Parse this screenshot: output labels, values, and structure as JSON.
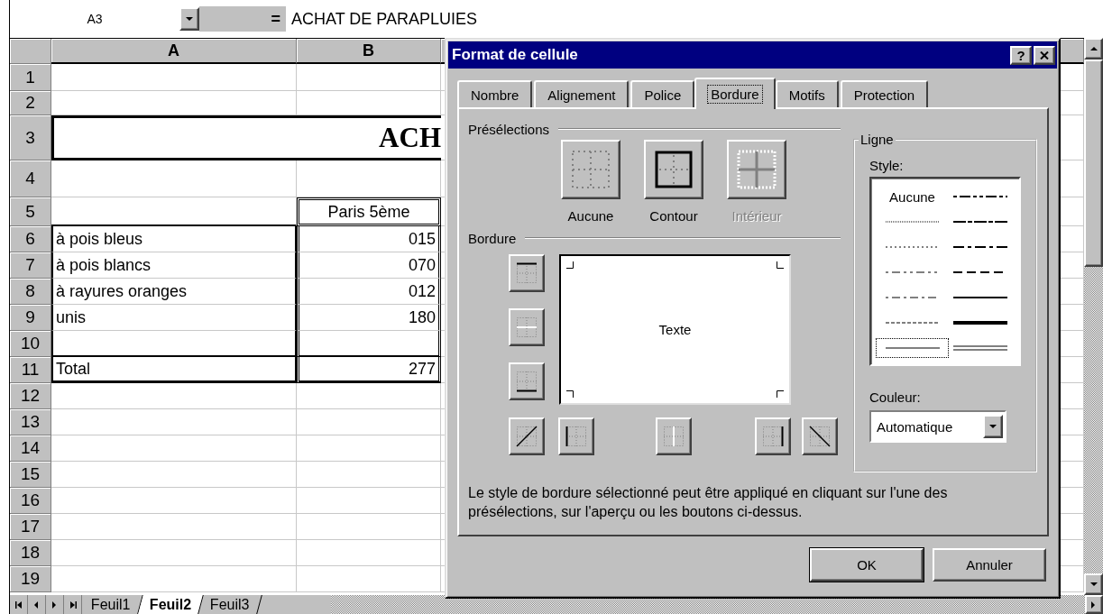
{
  "formula_bar": {
    "name_box": "A3",
    "equals_sign": "=",
    "formula": "ACHAT DE PARAPLUIES"
  },
  "sheet": {
    "columns": [
      "A",
      "B"
    ],
    "rows": [
      {
        "number": "1",
        "kind": "plain"
      },
      {
        "number": "2",
        "kind": "plain"
      },
      {
        "number": "3",
        "kind": "title",
        "text": "ACH"
      },
      {
        "number": "4",
        "kind": "plain"
      },
      {
        "number": "5",
        "kind": "header",
        "col_b": "Paris 5ème"
      },
      {
        "number": "6",
        "kind": "item",
        "col_a": "à pois bleus",
        "col_b": "015"
      },
      {
        "number": "7",
        "kind": "item",
        "col_a": "à pois blancs",
        "col_b": "070"
      },
      {
        "number": "8",
        "kind": "item",
        "col_a": "à rayures oranges",
        "col_b": "012"
      },
      {
        "number": "9",
        "kind": "item",
        "col_a": "unis",
        "col_b": "180"
      },
      {
        "number": "10",
        "kind": "spacer"
      },
      {
        "number": "11",
        "kind": "total",
        "col_a": "Total",
        "col_b": "277"
      },
      {
        "number": "12",
        "kind": "plain"
      },
      {
        "number": "13",
        "kind": "plain"
      },
      {
        "number": "14",
        "kind": "plain"
      },
      {
        "number": "15",
        "kind": "plain"
      },
      {
        "number": "16",
        "kind": "plain"
      },
      {
        "number": "17",
        "kind": "plain"
      },
      {
        "number": "18",
        "kind": "plain"
      },
      {
        "number": "19",
        "kind": "plain"
      }
    ],
    "tabs": [
      {
        "label": "Feuil1",
        "selected": false
      },
      {
        "label": "Feuil2",
        "selected": true
      },
      {
        "label": "Feuil3",
        "selected": false
      }
    ]
  },
  "dialog": {
    "title": "Format de cellule",
    "help": "?",
    "tabs": [
      {
        "label": "Nombre",
        "selected": false
      },
      {
        "label": "Alignement",
        "selected": false
      },
      {
        "label": "Police",
        "selected": false
      },
      {
        "label": "Bordure",
        "selected": true
      },
      {
        "label": "Motifs",
        "selected": false
      },
      {
        "label": "Protection",
        "selected": false
      }
    ],
    "presets": {
      "label": "Présélections",
      "items": [
        {
          "kind": "none",
          "label": "Aucune",
          "disabled": false
        },
        {
          "kind": "outline",
          "label": "Contour",
          "disabled": false
        },
        {
          "kind": "inside",
          "label": "Intérieur",
          "disabled": true
        }
      ]
    },
    "border": {
      "label": "Bordure",
      "preview_text": "Texte"
    },
    "line": {
      "label": "Ligne",
      "style_label": "Style:",
      "styles": [
        {
          "kind": "none",
          "label": "Aucune",
          "selected": false
        },
        {
          "kind": "medium-dash-dot-dot",
          "selected": false
        },
        {
          "kind": "hair",
          "selected": false
        },
        {
          "kind": "slant-dash-dot",
          "selected": false
        },
        {
          "kind": "dotted",
          "selected": false
        },
        {
          "kind": "medium-dash-dot",
          "selected": false
        },
        {
          "kind": "dash-dot-dot",
          "selected": false
        },
        {
          "kind": "medium-dashed",
          "selected": false
        },
        {
          "kind": "dash-dot",
          "selected": false
        },
        {
          "kind": "medium",
          "selected": false
        },
        {
          "kind": "dashed",
          "selected": false
        },
        {
          "kind": "thick",
          "selected": false
        },
        {
          "kind": "thin",
          "selected": true
        },
        {
          "kind": "double",
          "selected": false
        }
      ],
      "color_label": "Couleur:",
      "color_value": "Automatique"
    },
    "description": "Le style de bordure sélectionné peut être appliqué en cliquant sur l'une des présélections, sur l'aperçu ou les boutons ci-dessus.",
    "buttons": [
      {
        "label": "OK",
        "default": true
      },
      {
        "label": "Annuler",
        "default": false
      }
    ]
  }
}
